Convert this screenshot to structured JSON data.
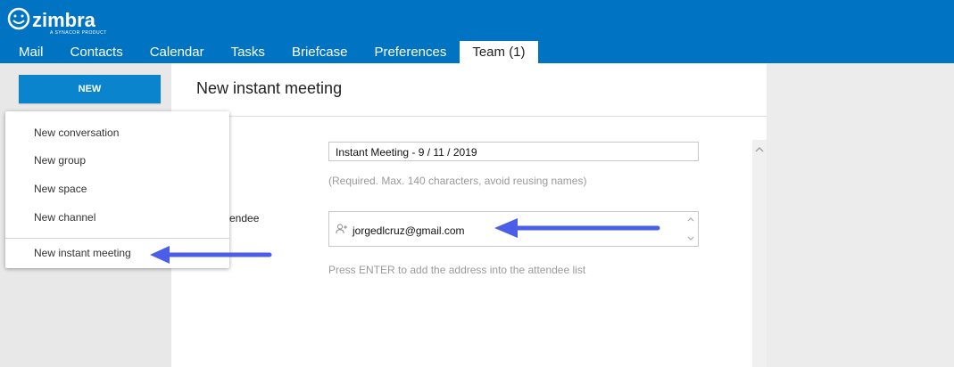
{
  "app": {
    "logo_text": "zimbra",
    "logo_sub": "A SYNACOR PRODUCT",
    "tabs": [
      {
        "label": "Mail"
      },
      {
        "label": "Contacts"
      },
      {
        "label": "Calendar"
      },
      {
        "label": "Tasks"
      },
      {
        "label": "Briefcase"
      },
      {
        "label": "Preferences"
      },
      {
        "label": "Team (1)"
      }
    ],
    "active_tab": "Team (1)"
  },
  "sidebar": {
    "new_button_label": "NEW",
    "menu": [
      {
        "label": "New conversation"
      },
      {
        "label": "New group"
      },
      {
        "label": "New space"
      },
      {
        "label": "New channel"
      },
      {
        "label": "New instant meeting"
      }
    ]
  },
  "main": {
    "title": "New instant meeting",
    "name_value": "Instant Meeting - 9 / 11 / 2019",
    "name_hint": "(Required. Max. 140 characters, avoid reusing names)",
    "attendee_label": "endee",
    "attendee_value": "jorgedlcruz@gmail.com",
    "attendee_hint": "Press ENTER to add the address into the attendee list"
  },
  "colors": {
    "header_bg": "#0074c2",
    "new_button_bg": "#0a84cc",
    "annotation_arrow": "#4b5ee8"
  }
}
